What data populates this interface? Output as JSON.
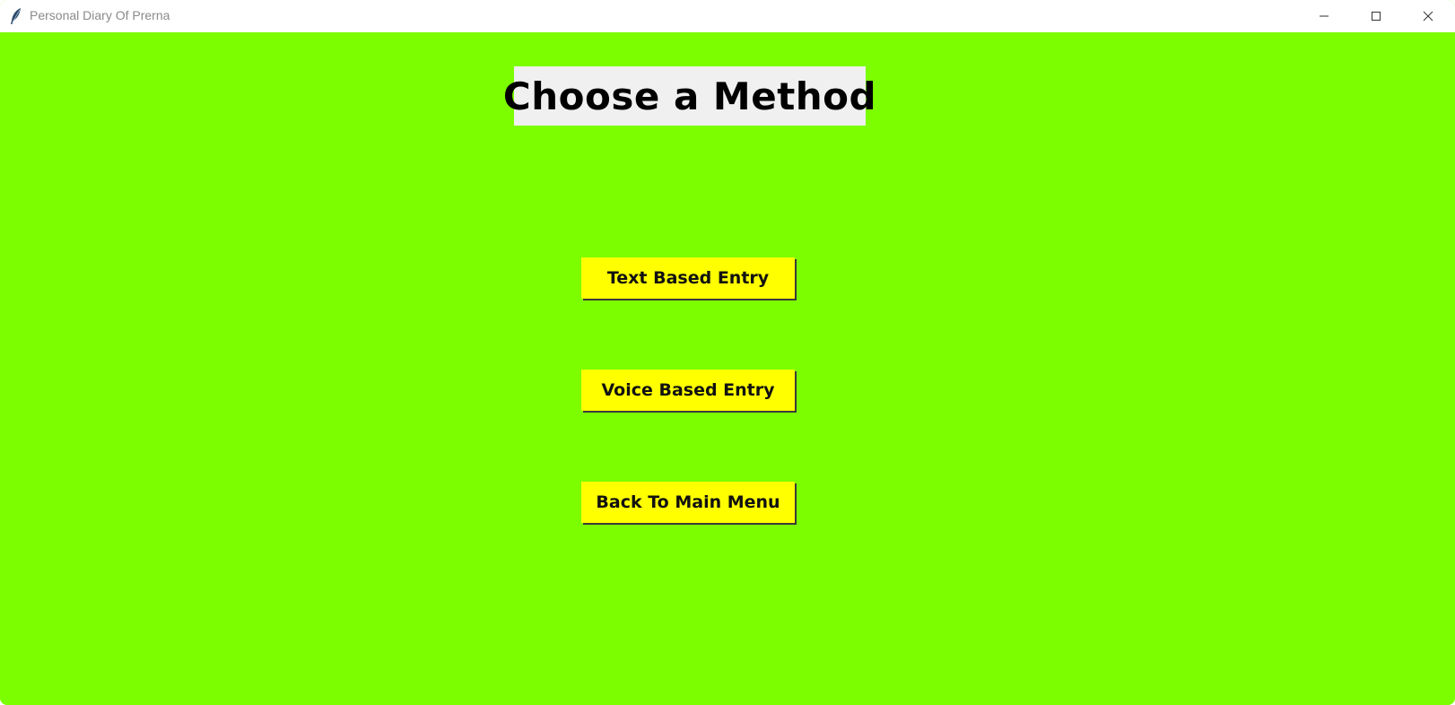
{
  "window": {
    "title": "Personal Diary Of Prerna",
    "background_color": "#7cfe00",
    "controls": [
      "minimize-icon",
      "maximize-icon",
      "close-icon"
    ]
  },
  "main": {
    "heading": "Choose a Method",
    "heading_background": "#f0f0f0",
    "button_color": "#ffff00",
    "buttons": [
      {
        "label": "Text Based Entry"
      },
      {
        "label": "Voice Based Entry"
      },
      {
        "label": "Back To Main Menu"
      }
    ]
  }
}
